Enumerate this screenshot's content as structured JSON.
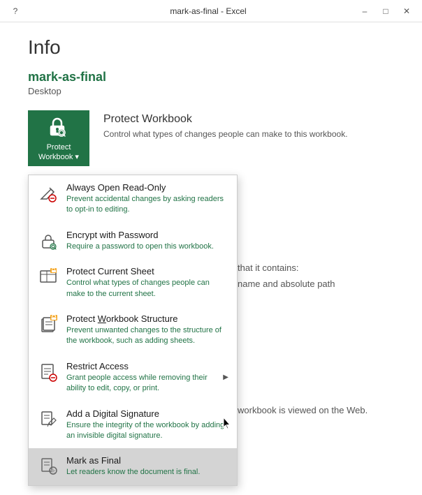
{
  "titleBar": {
    "title": "mark-as-final  -  Excel",
    "helpLabel": "?",
    "minimizeLabel": "–",
    "maximizeLabel": "□",
    "closeLabel": "✕"
  },
  "page": {
    "title": "Info",
    "fileName": "mark-as-final",
    "fileLocation": "Desktop"
  },
  "protectWorkbook": {
    "buttonLabel": "Protect\nWorkbook",
    "sectionTitle": "Protect Workbook",
    "sectionDesc": "Control what types of changes people can make to this workbook."
  },
  "dropdownMenu": {
    "items": [
      {
        "id": "always-open-read-only",
        "title": "Always Open Read-Only",
        "underlineLetter": "A",
        "desc": "Prevent accidental changes by asking readers to opt-in to editing.",
        "hasArrow": false,
        "highlighted": false
      },
      {
        "id": "encrypt-with-password",
        "title": "Encrypt with Password",
        "underlineLetter": "E",
        "desc": "Require a password to open this workbook.",
        "hasArrow": false,
        "highlighted": false
      },
      {
        "id": "protect-current-sheet",
        "title": "Protect Current Sheet",
        "underlineLetter": "P",
        "desc": "Control what types of changes people can make to the current sheet.",
        "hasArrow": false,
        "highlighted": false
      },
      {
        "id": "protect-workbook-structure",
        "title": "Protect Workbook Structure",
        "underlineLetter": "W",
        "desc": "Prevent unwanted changes to the structure of the workbook, such as adding sheets.",
        "hasArrow": false,
        "highlighted": false
      },
      {
        "id": "restrict-access",
        "title": "Restrict Access",
        "underlineLetter": "R",
        "desc": "Grant people access while removing their ability to edit, copy, or print.",
        "hasArrow": true,
        "highlighted": false
      },
      {
        "id": "add-digital-signature",
        "title": "Add a Digital Signature",
        "underlineLetter": "D",
        "desc": "Ensure the integrity of the workbook by adding an invisible digital signature.",
        "hasArrow": false,
        "highlighted": false
      },
      {
        "id": "mark-as-final",
        "title": "Mark as Final",
        "underlineLetter": "M",
        "desc": "Let readers know the document is final.",
        "hasArrow": false,
        "highlighted": true
      }
    ]
  },
  "infoSection": {
    "line1": "that it contains:",
    "line2": "name and absolute path"
  }
}
